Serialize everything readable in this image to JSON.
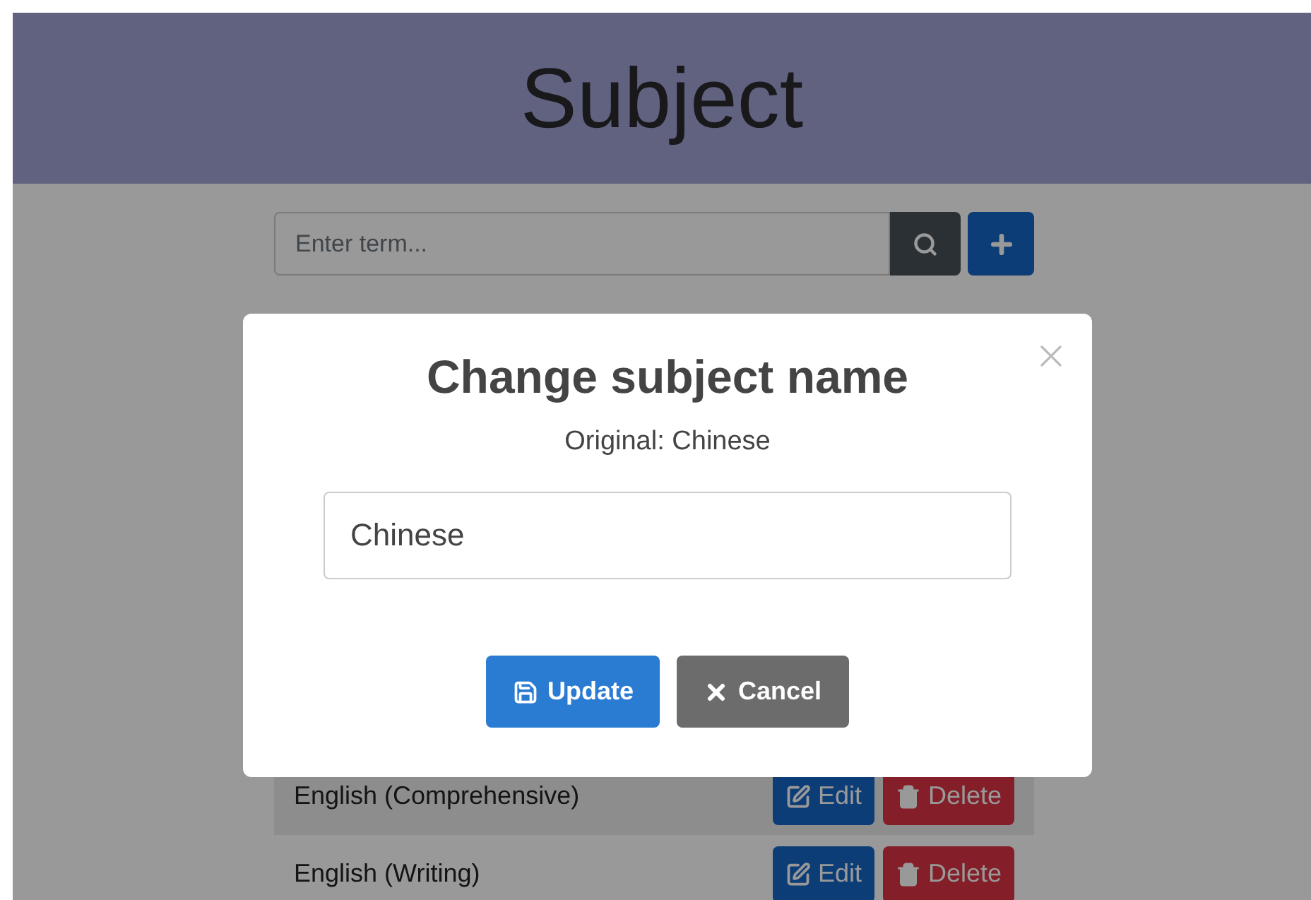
{
  "header": {
    "title": "Subject"
  },
  "search": {
    "placeholder": "Enter term..."
  },
  "rows": [
    {
      "name": "English (Comprehensive)",
      "edit": "Edit",
      "delete": "Delete"
    },
    {
      "name": "English (Writing)",
      "edit": "Edit",
      "delete": "Delete"
    }
  ],
  "modal": {
    "title": "Change subject name",
    "original": "Original: Chinese",
    "input_value": "Chinese",
    "buttons": [
      {
        "kind": "update",
        "label": "Update"
      },
      {
        "kind": "cancel",
        "label": "Cancel"
      }
    ]
  }
}
